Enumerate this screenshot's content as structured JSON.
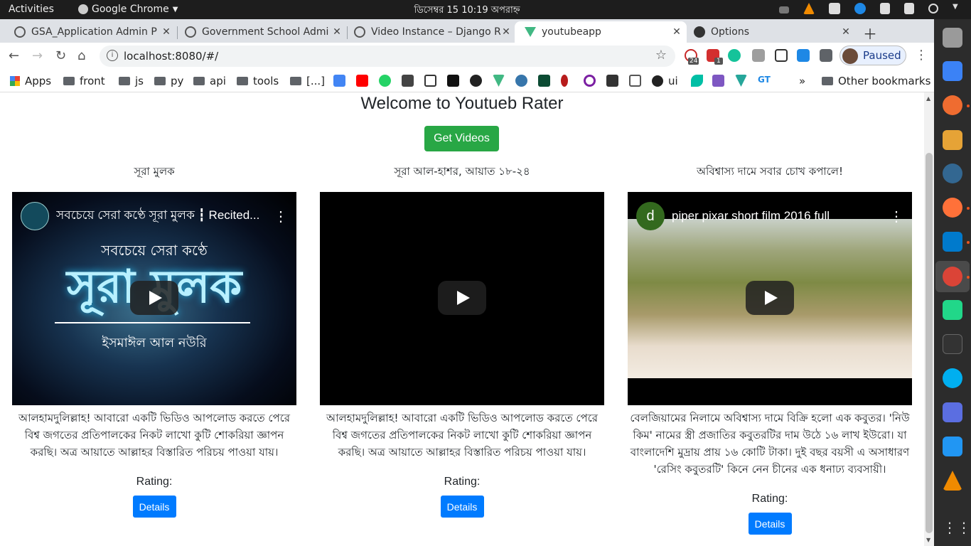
{
  "os": {
    "activities": "Activities",
    "app_name": "Google Chrome",
    "clock": "ডিসেম্বর 15  10:19 অপরাহ্ন"
  },
  "browser": {
    "tabs": [
      {
        "title": "GSA_Application Admin P",
        "active": false
      },
      {
        "title": "Government School Admi",
        "active": false
      },
      {
        "title": "Video Instance – Django R",
        "active": false
      },
      {
        "title": "youtubeapp",
        "active": true
      },
      {
        "title": "Options",
        "active": false
      }
    ],
    "url": "localhost:8080/#/",
    "profile_label": "Paused",
    "ext_badges": [
      "24",
      "1"
    ],
    "bookmarks": [
      "Apps",
      "front",
      "js",
      "py",
      "api",
      "tools",
      "[...]",
      "ui"
    ],
    "other_bookmarks": "Other bookmarks",
    "overflow": "»"
  },
  "page": {
    "welcome": "Welcome to Youtueb Rater",
    "get_videos": "Get Videos",
    "rating_label": "Rating:",
    "details_label": "Details",
    "videos": [
      {
        "title": "সূরা মুলক",
        "video_title": "সবচেয়ে সেরা কণ্ঠে সূরা মুলক ┇ Recited...",
        "thumb_line1": "সবচেয়ে সেরা কণ্ঠে",
        "thumb_big": "সূরা মুলক",
        "thumb_line2": "ইসমাঈল আল নউরি",
        "description": "আলহামদুলিল্লাহ! আবারো একটি ভিডিও আপলোড করতে পেরে বিশ্ব জগতের প্রতিপালকের নিকট লাখো কুটি শোকরিয়া জ্ঞাপন করছি। অত্র আয়াতে আল্লাহর বিস্তারিত পরিচয় পাওয়া যায়।"
      },
      {
        "title": "সূরা আল-হাশর, আয়াত ১৮-২৪",
        "video_title": "",
        "description": "আলহামদুলিল্লাহ! আবারো একটি ভিডিও আপলোড করতে পেরে বিশ্ব জগতের প্রতিপালকের নিকট লাখো কুটি শোকরিয়া জ্ঞাপন করছি। অত্র আয়াতে আল্লাহর বিস্তারিত পরিচয় পাওয়া যায়।"
      },
      {
        "title": "অবিশ্বাস্য দামে সবার চোখ কপালে!",
        "video_title": "piper pixar short film 2016 full",
        "channel_initial": "d",
        "description": "বেলজিয়ামের নিলামে অবিশ্বাস্য দামে বিক্রি হলো এক কবুতর। 'নিউ কিম' নামের স্ত্রী প্রজাতির কবুতরটির দাম উঠে ১৬ লাখ ইউরো। যা বাংলাদেশি মুদ্রায় প্রায় ১৬ কোটি টাকা। দুই বছর বয়সী এ অসাধারণ 'রেসিং কবুতরটি' কিনে নেন চীনের এক ধনাঢ্য ব্যবসায়ী।"
      }
    ]
  },
  "colors": {
    "green": "#28a745",
    "blue": "#007bff",
    "dock": "#2c2c2c",
    "topbar": "#1d1d1d"
  }
}
